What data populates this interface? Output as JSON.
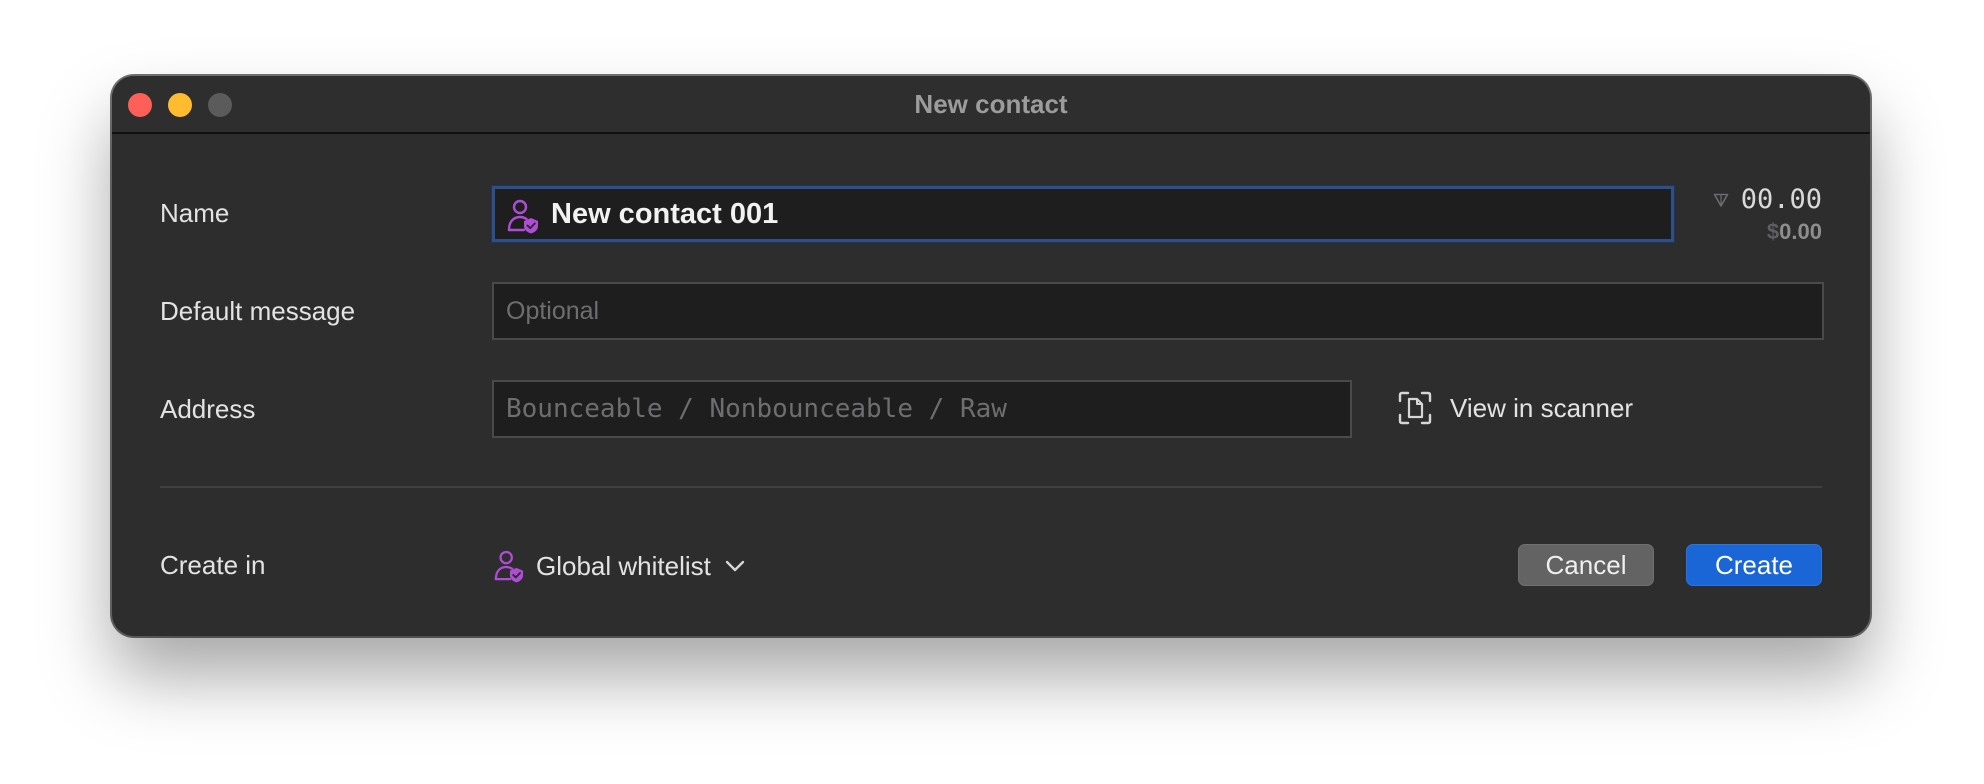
{
  "window": {
    "title": "New contact"
  },
  "form": {
    "name_label": "Name",
    "name_value": "New contact 001",
    "message_label": "Default message",
    "message_placeholder": "Optional",
    "address_label": "Address",
    "address_placeholder": "Bounceable / Nonbounceable / Raw",
    "scanner_label": "View in scanner",
    "create_in_label": "Create in",
    "create_in_value": "Global whitelist"
  },
  "balance": {
    "amount": "00.00",
    "usd_symbol": "$",
    "usd_value": "0.00"
  },
  "actions": {
    "cancel_label": "Cancel",
    "create_label": "Create"
  },
  "colors": {
    "accent": "#1a66d6",
    "contact_icon": "#b04cd6",
    "close": "#fe5f57",
    "minimize": "#febc2e"
  },
  "icons": {
    "contact": "person-shield-icon",
    "scanner": "scan-document-icon",
    "balance": "ton-triangle-icon",
    "dropdown": "chevron-down-icon"
  }
}
